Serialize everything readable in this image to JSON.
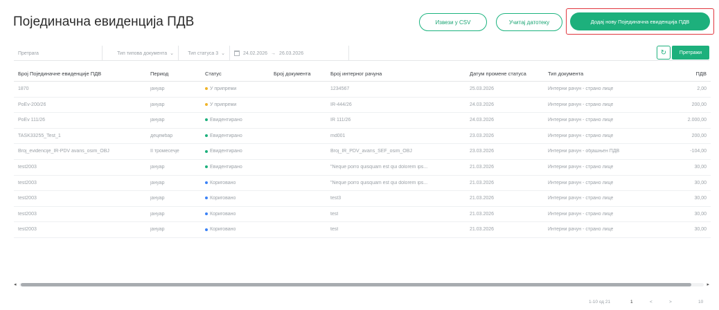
{
  "header": {
    "title": "Појединачна евиденција ПДВ",
    "export_label": "Извези у CSV",
    "import_label": "Учитај датотеку",
    "add_label": "Додај нову Појединачна евиденција ПДВ"
  },
  "filters": {
    "search_placeholder": "Претрага",
    "document_type": "Тип типова документа",
    "status": "Тип статуса 3",
    "date_from": "24.02.2026",
    "date_sep": "→",
    "date_to": "26.03.2026",
    "refresh_icon": "refresh-icon",
    "search_label": "Претражи"
  },
  "table": {
    "columns": [
      "Број Појединачне евиденције ПДВ",
      "Период",
      "Статус",
      "Број документа",
      "Број интерног рачуна",
      "Датум промене статуса",
      "Тип документа",
      "ПДВ"
    ],
    "rows": [
      {
        "id": "1870",
        "period": "јануар",
        "status": "У припреми",
        "status_color": "#f0b429",
        "doc": "",
        "internal": "1234567",
        "date": "25.03.2026",
        "type": "Интерни рачун - страно лице",
        "vat": "2,00"
      },
      {
        "id": "PoEv-200/26",
        "period": "јануар",
        "status": "У припреми",
        "status_color": "#f0b429",
        "doc": "",
        "internal": "IR-444/26",
        "date": "24.03.2026",
        "type": "Интерни рачун - страно лице",
        "vat": "200,00"
      },
      {
        "id": "PoEv 111/26",
        "period": "јануар",
        "status": "Евидентирано",
        "status_color": "#1db07c",
        "doc": "",
        "internal": "IR 111/26",
        "date": "24.03.2026",
        "type": "Интерни рачун - страно лице",
        "vat": "2.000,00"
      },
      {
        "id": "TASK33255_Test_1",
        "period": "децембар",
        "status": "Евидентирано",
        "status_color": "#1db07c",
        "doc": "",
        "internal": "md001",
        "date": "23.03.2026",
        "type": "Интерни рачун - страно лице",
        "vat": "200,00"
      },
      {
        "id": "Broj_evidencije_IR-PDV avans_osim_OBJ",
        "period": "II тромесечје",
        "status": "Евидентирано",
        "status_color": "#1db07c",
        "doc": "",
        "internal": "Broj_IR_PDV_avans_SEF_osim_OBJ",
        "date": "23.03.2026",
        "type": "Интерни рачун - објашњен ПДВ",
        "vat": "-104,00"
      },
      {
        "id": "test2003",
        "period": "јануар",
        "status": "Евидентирано",
        "status_color": "#1db07c",
        "doc": "",
        "internal": "\"Neque porro quisquam est qui dolorem ips...",
        "date": "21.03.2026",
        "type": "Интерни рачун - страно лице",
        "vat": "30,00"
      },
      {
        "id": "test2003",
        "period": "јануар",
        "status": "Кориговано",
        "status_color": "#3b82f6",
        "doc": "",
        "internal": "\"Neque porro quisquam est qui dolorem ips...",
        "date": "21.03.2026",
        "type": "Интерни рачун - страно лице",
        "vat": "30,00"
      },
      {
        "id": "test2003",
        "period": "јануар",
        "status": "Кориговано",
        "status_color": "#3b82f6",
        "doc": "",
        "internal": "test3",
        "date": "21.03.2026",
        "type": "Интерни рачун - страно лице",
        "vat": "30,00"
      },
      {
        "id": "test2003",
        "period": "јануар",
        "status": "Кориговано",
        "status_color": "#3b82f6",
        "doc": "",
        "internal": "test",
        "date": "21.03.2026",
        "type": "Интерни рачун - страно лице",
        "vat": "30,00"
      },
      {
        "id": "test2003",
        "period": "јануар",
        "status": "Кориговано",
        "status_color": "#3b82f6",
        "doc": "",
        "internal": "test",
        "date": "21.03.2026",
        "type": "Интерни рачун - страно лице",
        "vat": "30,00"
      }
    ]
  },
  "pagination": {
    "range": "1-10 од 21",
    "page": "1",
    "prev": "<",
    "next": ">",
    "page_size": "10"
  },
  "colors": {
    "accent": "#1db07c",
    "highlight_border": "#e0343c"
  }
}
